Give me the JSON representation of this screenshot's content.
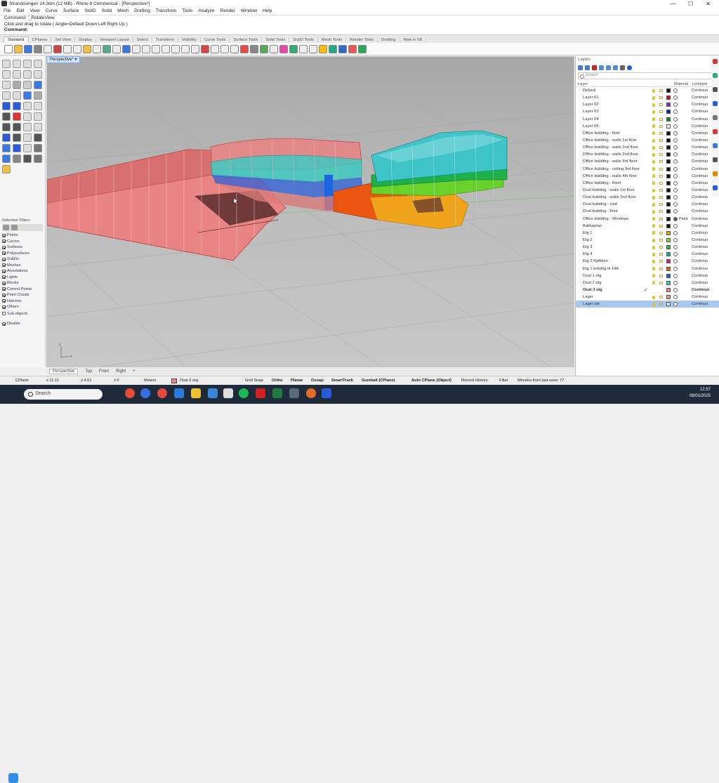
{
  "window": {
    "title": "Strandsvingen 14.3dm (12 MB) - Rhino 8 Commercial - [Perspective*]",
    "controls": [
      "—",
      "☐",
      "✕"
    ]
  },
  "menu": [
    "File",
    "Edit",
    "View",
    "Curve",
    "Surface",
    "SubD",
    "Solid",
    "Mesh",
    "Drafting",
    "Transform",
    "Tools",
    "Analyze",
    "Render",
    "Window",
    "Help"
  ],
  "command": {
    "history1": "Command: '_RotateView",
    "history2": "Click and drag to rotate ( Angle=Default  Down  Left  Right  Up )",
    "prompt": "Command:"
  },
  "toolbar_tabs": [
    "Standard",
    "CPlanes",
    "Set View",
    "Display",
    "Viewport Layout",
    "Select",
    "Transform",
    "Visibility",
    "Curve Tools",
    "Surface Tools",
    "Solid Tools",
    "SubD Tools",
    "Mesh Tools",
    "Render Tools",
    "Drafting",
    "New in V8"
  ],
  "viewport": {
    "title": "Perspective*",
    "dropdown": "▾"
  },
  "viewport_tabs": [
    "Perspective",
    "Top",
    "Front",
    "Right",
    "+"
  ],
  "selection_filters": {
    "title": "Selection Filters",
    "items": [
      {
        "label": "Points",
        "checked": true
      },
      {
        "label": "Curves",
        "checked": true
      },
      {
        "label": "Surfaces",
        "checked": true
      },
      {
        "label": "Polysurfaces",
        "checked": true
      },
      {
        "label": "SubDs",
        "checked": true
      },
      {
        "label": "Meshes",
        "checked": true
      },
      {
        "label": "Annotations",
        "checked": true
      },
      {
        "label": "Lights",
        "checked": true
      },
      {
        "label": "Blocks",
        "checked": true
      },
      {
        "label": "Control Points",
        "checked": true
      },
      {
        "label": "Point Clouds",
        "checked": true
      },
      {
        "label": "Hatches",
        "checked": true
      },
      {
        "label": "Others",
        "checked": true
      },
      {
        "label": "Sub-objects",
        "checked": false
      }
    ],
    "disable": "Disable"
  },
  "layers": {
    "title": "Layers",
    "search_placeholder": "Search",
    "col_layer": "Layer",
    "col_material": "Material",
    "col_linetype": "Linetype",
    "rows": [
      {
        "name": "Default",
        "color": "#111111",
        "lt": "Continuo"
      },
      {
        "name": "Layer 01",
        "color": "#d01010",
        "lt": "Continuo"
      },
      {
        "name": "Layer 02",
        "color": "#8a2bd0",
        "lt": "Continuo"
      },
      {
        "name": "Layer 03",
        "color": "#1020c0",
        "lt": "Continuo"
      },
      {
        "name": "Layer 04",
        "color": "#109010",
        "lt": "Continuo"
      },
      {
        "name": "Layer 05",
        "color": "#ffffff",
        "lt": "Continuo"
      },
      {
        "name": "Office building - floor",
        "color": "#111111",
        "lt": "Continuo"
      },
      {
        "name": "Office building - walls 1st floor",
        "color": "#111111",
        "lt": "Continuo"
      },
      {
        "name": "Office building - walls 2nd floor",
        "color": "#111111",
        "lt": "Continuo"
      },
      {
        "name": "Office building - walls 2nd floor",
        "color": "#111111",
        "lt": "Continuo"
      },
      {
        "name": "Office building - walls 3rd floor",
        "color": "#111111",
        "lt": "Continuo"
      },
      {
        "name": "Office building - ceiling 3rd floor",
        "color": "#111111",
        "lt": "Continuo"
      },
      {
        "name": "Office building - walls 4th floor",
        "color": "#111111",
        "lt": "Continuo"
      },
      {
        "name": "Office building - Roof",
        "color": "#111111",
        "lt": "Continuo"
      },
      {
        "name": "Oval building - walls 1st floor",
        "color": "#111111",
        "lt": "Continuo"
      },
      {
        "name": "Oval building - walls 2nd floor",
        "color": "#111111",
        "lt": "Continuo"
      },
      {
        "name": "Oval building - roof",
        "color": "#111111",
        "lt": "Continuo"
      },
      {
        "name": "Oval building - floor",
        "color": "#111111",
        "lt": "Continuo"
      },
      {
        "name": "Office building - Windows",
        "color": "#111111",
        "lt": "Continuo",
        "material": "Paint"
      },
      {
        "name": "Bakkeplan",
        "color": "#111111",
        "lt": "Continuo"
      },
      {
        "name": "Etg 1",
        "color": "#e8a21a",
        "lt": "Continuo"
      },
      {
        "name": "Etg 2",
        "color": "#8bd12b",
        "lt": "Continuo"
      },
      {
        "name": "Etg 3",
        "color": "#2bb84a",
        "lt": "Continuo"
      },
      {
        "name": "Etg 4",
        "color": "#1fa8a0",
        "lt": "Continuo"
      },
      {
        "name": "Etg 2 Kjøkken",
        "color": "#d0208a",
        "lt": "Continuo"
      },
      {
        "name": "Etg 1 kobling til 14A",
        "color": "#e0601a",
        "lt": "Continuo"
      },
      {
        "name": "Oval 1 etg",
        "color": "#2a5ad8",
        "lt": "Continuo"
      },
      {
        "name": "Oval 2 etg",
        "color": "#2bd0c8",
        "lt": "Continuo"
      },
      {
        "name": "Oval 3 etg",
        "color": "#e88a8a",
        "lt": "Continuo",
        "current": true
      },
      {
        "name": "Lager",
        "color": "#e89a8a",
        "lt": "Continuo"
      },
      {
        "name": "Lager tak",
        "color": "#e8e8e8",
        "lt": "Continuo",
        "selected": true
      }
    ]
  },
  "status": {
    "cplane": "CPlane",
    "x": "x 11.11",
    "y": "y 4.61",
    "z": "z 0",
    "units": "Meters",
    "layer": "Oval 3 etg",
    "layer_color": "#e88a8a",
    "grid_snap": "Grid Snap",
    "ortho": "Ortho",
    "planar": "Planar",
    "osnap": "Osnap",
    "smarttrack": "SmartTrack",
    "gumball": "Gumball (CPlane)",
    "autocplane": "Auto CPlane (Object)",
    "record": "Record History",
    "filter": "Filter",
    "saved": "Minutes from last save: 77"
  },
  "taskbar": {
    "search": "Search",
    "time": "12:57",
    "date": "08/01/2025"
  }
}
